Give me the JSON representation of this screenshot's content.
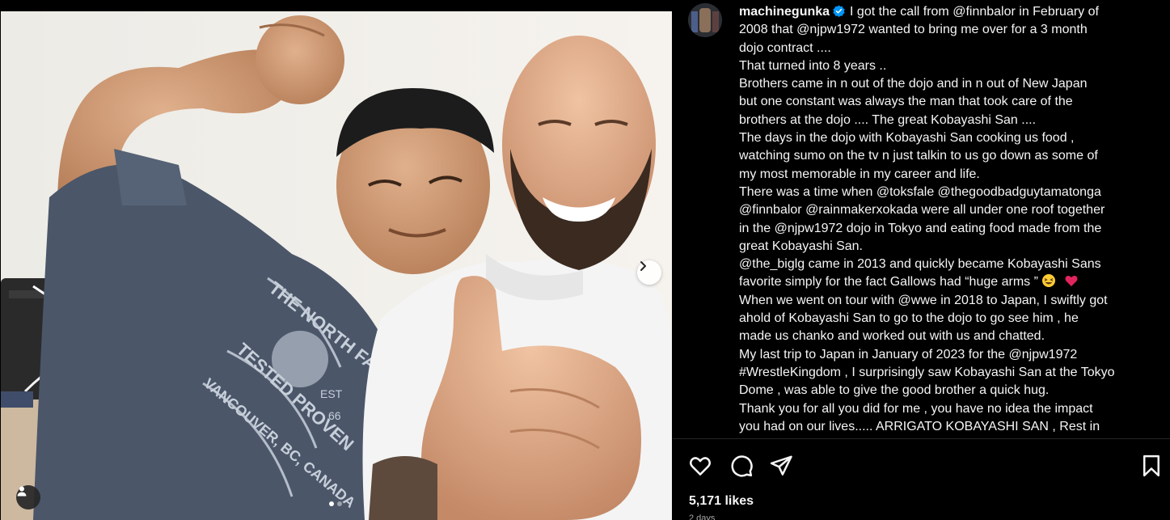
{
  "post": {
    "username": "machinegunka",
    "caption_lines": [
      "I got the call from @finnbalor in February of",
      "2008 that @njpw1972 wanted to bring me over for a 3 month",
      "dojo contract ....",
      "That turned into 8 years ..",
      "Brothers came in n out of the dojo and in n out of New Japan",
      "but one constant was always the man that took care of the",
      "brothers at the dojo .... The great Kobayashi San ....",
      "The days in the dojo with Kobayashi San cooking us food ,",
      "watching sumo on the tv n just talkin to us go down as some of",
      "my most memorable in my career and life.",
      "There was a time when @toksfale @thegoodbadguytamatonga",
      "@finnbalor @rainmakerxokada were all under one roof together",
      "in the @njpw1972 dojo in Tokyo and eating food made from the",
      "great Kobayashi San.",
      "@the_biglg came in 2013 and quickly became Kobayashi Sans",
      "favorite simply for the fact Gallows had “huge arms ”",
      "When we went on tour with @wwe in 2018 to Japan, I swiftly got",
      "ahold of Kobayashi San to go to the dojo to go see him , he",
      "made us chanko and worked out with us and chatted.",
      "My last trip to Japan in January of 2023 for the @njpw1972",
      "#WrestleKingdom , I surprisingly saw Kobayashi San at the Tokyo",
      "Dome , was able to give the good brother a quick hug.",
      "Thank you for all you did for me , you have no idea the impact",
      "you had on our lives..... ARRIGATO KOBAYASHI SAN , Rest in"
    ],
    "likes_text": "5,171 likes",
    "time_hint": "2 days"
  },
  "carousel": {
    "current_index": 1,
    "total": 2
  },
  "shirt_text": {
    "line1": "THE NORTH FACE",
    "line2": "TESTED PROVEN",
    "line3": "VANCOUVER, BC, CANADA",
    "est": "EST",
    "year": "66"
  },
  "icons": {
    "verified": "verified-badge-icon",
    "like": "heart-icon",
    "comment": "comment-bubble-icon",
    "share": "paper-plane-icon",
    "save": "bookmark-icon",
    "next": "chevron-right-icon",
    "tag": "user-tag-icon"
  },
  "colors": {
    "background": "#000000",
    "text": "#f5f5f5",
    "verified": "#0095f6",
    "divider": "#262626",
    "heart_emoji": "#e0245e"
  }
}
